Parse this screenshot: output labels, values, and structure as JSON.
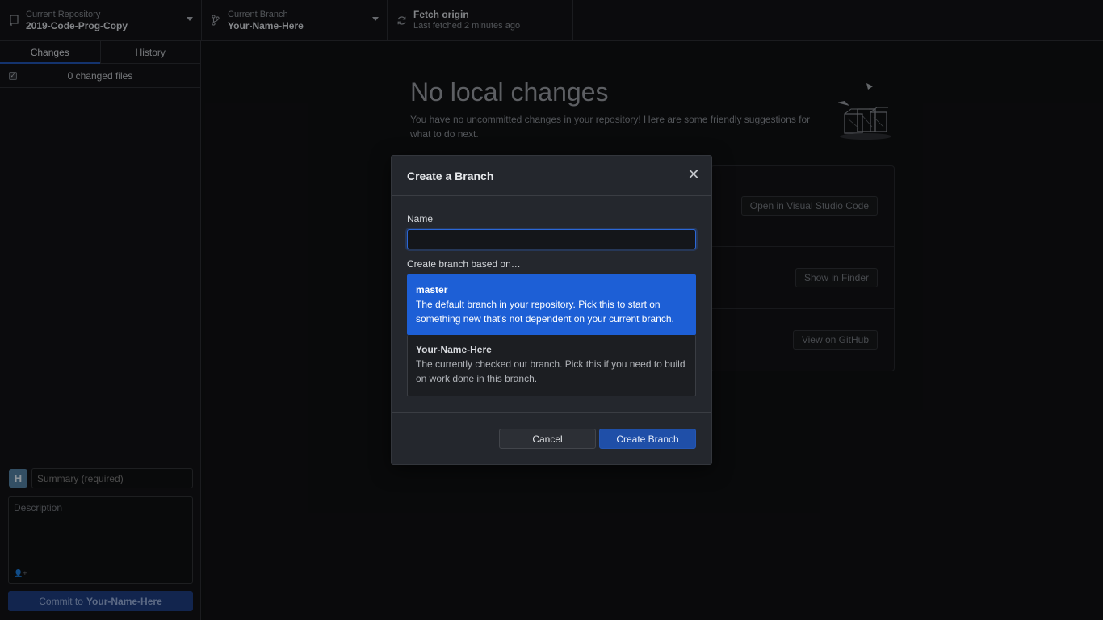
{
  "toolbar": {
    "repo": {
      "label": "Current Repository",
      "value": "2019-Code-Prog-Copy"
    },
    "branch": {
      "label": "Current Branch",
      "value": "Your-Name-Here"
    },
    "fetch": {
      "label": "Fetch origin",
      "value": "Last fetched 2 minutes ago"
    }
  },
  "sidebar": {
    "tabs": [
      "Changes",
      "History"
    ],
    "active_tab": "Changes",
    "changed_files": "0 changed files",
    "commit": {
      "avatar_letter": "H",
      "summary_placeholder": "Summary (required)",
      "description_placeholder": "Description",
      "button_prefix": "Commit to",
      "button_branch": "Your-Name-Here"
    }
  },
  "main": {
    "title": "No local changes",
    "subtitle": "You have no uncommitted changes in your repository! Here are some friendly suggestions for what to do next.",
    "suggestions": [
      "Open in Visual Studio Code",
      "Show in Finder",
      "View on GitHub"
    ]
  },
  "modal": {
    "title": "Create a Branch",
    "name_label": "Name",
    "name_value": "",
    "based_on_label": "Create branch based on…",
    "options": [
      {
        "name": "master",
        "description": "The default branch in your repository. Pick this to start on something new that's not dependent on your current branch.",
        "selected": true
      },
      {
        "name": "Your-Name-Here",
        "description": "The currently checked out branch. Pick this if you need to build on work done in this branch.",
        "selected": false
      }
    ],
    "cancel_label": "Cancel",
    "create_label": "Create Branch"
  },
  "colors": {
    "accent": "#1d5fd6",
    "primary_button": "#1f4fa8",
    "background": "#0f1012",
    "modal_background": "#24272d"
  }
}
